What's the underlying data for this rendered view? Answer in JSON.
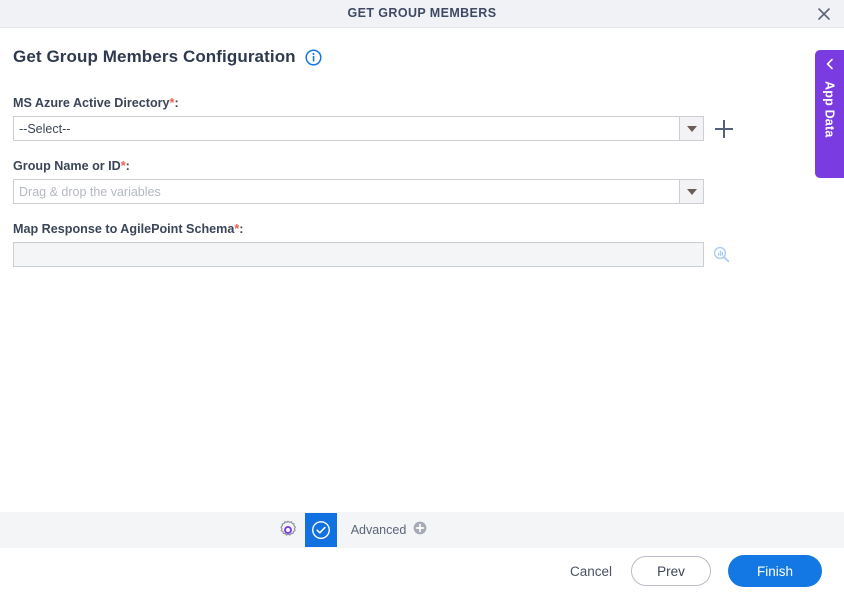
{
  "window": {
    "title": "GET GROUP MEMBERS",
    "close_icon": "close-icon"
  },
  "header": {
    "title": "Get Group Members Configuration",
    "info_icon": "info-icon"
  },
  "form": {
    "fields": [
      {
        "label": "MS Azure Active Directory",
        "required_marker": "*",
        "colon": ":",
        "value": "--Select--",
        "control": "dropdown",
        "dropdown_icon": "chevron-down-icon",
        "action_icon": "plus-icon"
      },
      {
        "label": "Group Name or ID",
        "required_marker": "*",
        "colon": ":",
        "placeholder": "Drag & drop the variables",
        "value": "",
        "control": "dropdown",
        "dropdown_icon": "chevron-down-icon"
      },
      {
        "label": "Map Response to AgilePoint Schema",
        "required_marker": "*",
        "colon": ":",
        "value": "",
        "control": "textbox",
        "action_icon": "search-schema-icon"
      }
    ]
  },
  "app_data_tab": {
    "label": "App Data",
    "chevron_icon": "chevron-left-icon"
  },
  "toolbar": {
    "gear_icon": "gear-icon",
    "validate_icon": "check-circle-icon",
    "advanced_label": "Advanced",
    "advanced_add_icon": "plus-circle-icon"
  },
  "footer": {
    "cancel_label": "Cancel",
    "prev_label": "Prev",
    "finish_label": "Finish"
  },
  "colors": {
    "primary": "#1378e3",
    "accent_purple": "#7a3ce0",
    "required": "#e8604c",
    "title_bar": "#f1f2f5",
    "toolbar": "#f4f5f7"
  }
}
